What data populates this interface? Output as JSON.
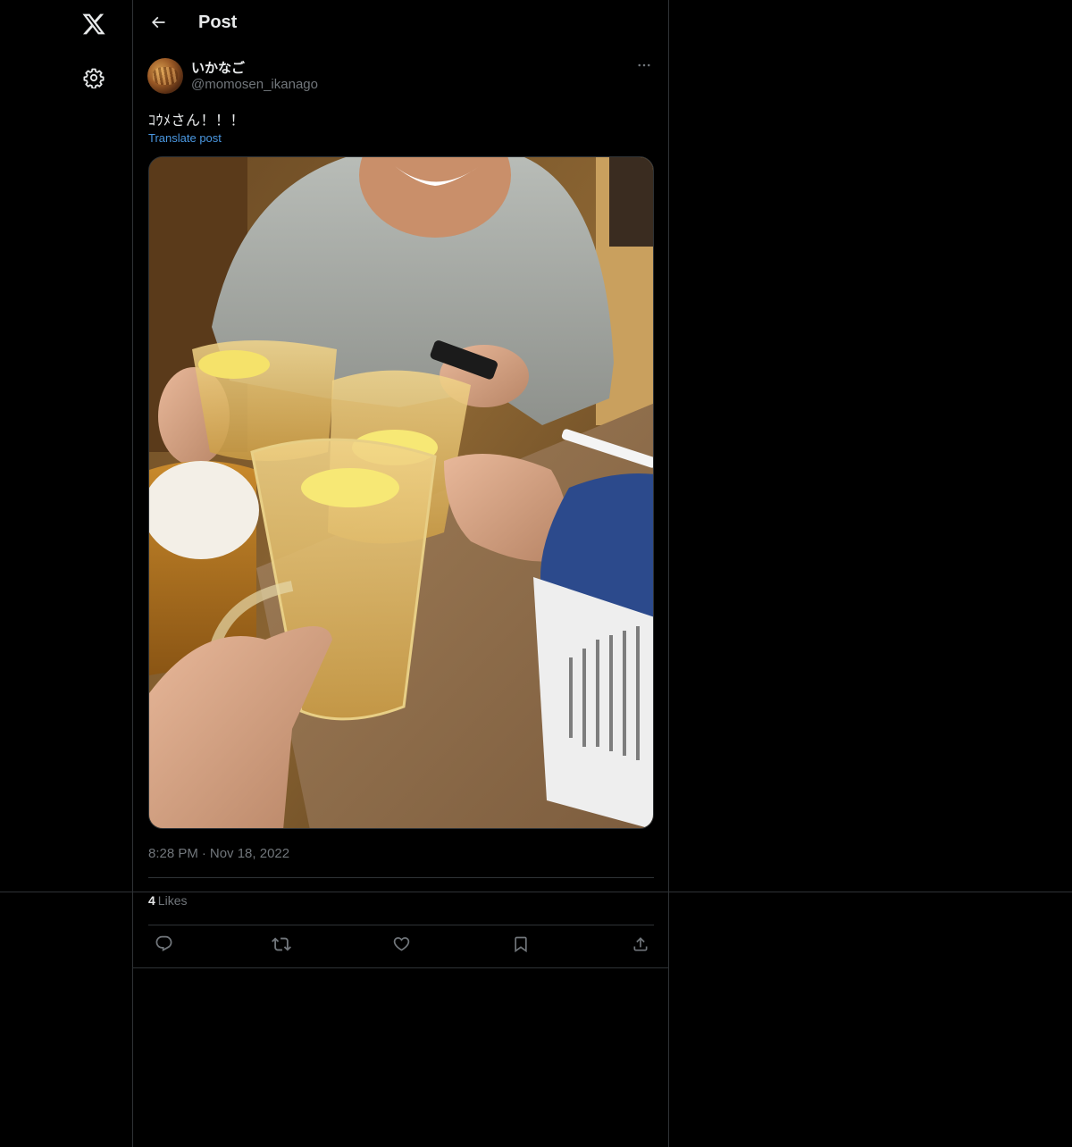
{
  "nav": {
    "logo_icon": "x-logo-icon",
    "settings_icon": "gear-icon"
  },
  "header": {
    "back_icon": "arrow-left-icon",
    "title": "Post"
  },
  "post": {
    "author": {
      "display_name": "いかなご",
      "handle": "@momosen_ikanago"
    },
    "more_icon": "ellipsis-icon",
    "text": "ｺｳﾒさん！！！",
    "translate_label": "Translate post",
    "time": "8:28 PM",
    "separator": "·",
    "date": "Nov 18, 2022",
    "likes_count": "4",
    "likes_label": "Likes",
    "actions": [
      {
        "name": "reply",
        "icon": "reply-icon"
      },
      {
        "name": "repost",
        "icon": "repost-icon"
      },
      {
        "name": "like",
        "icon": "heart-icon"
      },
      {
        "name": "bookmark",
        "icon": "bookmark-icon"
      },
      {
        "name": "share",
        "icon": "share-icon"
      }
    ]
  },
  "colors": {
    "background": "#000000",
    "text_primary": "#e7e9ea",
    "text_secondary": "#71767b",
    "link": "#4a97e0",
    "border": "#2f3336"
  }
}
